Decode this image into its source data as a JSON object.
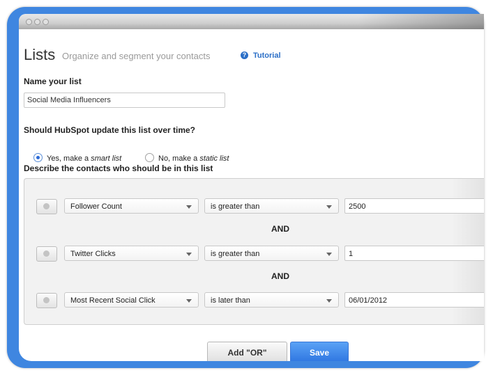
{
  "header": {
    "title": "Lists",
    "subtitle": "Organize and segment your contacts",
    "tutorial": "Tutorial"
  },
  "name_field": {
    "label": "Name your list",
    "value": "Social Media Influencers"
  },
  "update": {
    "question": "Should HubSpot update this list over time?",
    "smart": {
      "prefix": "Yes, make a ",
      "em": "smart list",
      "selected": true
    },
    "static": {
      "prefix": "No, make a ",
      "em": "static list",
      "selected": false
    }
  },
  "criteria": {
    "label": "Describe the contacts who should be in this list",
    "rows": [
      {
        "property": "Follower Count",
        "operator": "is greater than",
        "value": "2500"
      },
      {
        "property": "Twitter Clicks",
        "operator": "is greater than",
        "value": "1"
      },
      {
        "property": "Most Recent Social Click",
        "operator": "is later than",
        "value": "06/01/2012"
      }
    ],
    "joiner": "AND"
  },
  "buttons": {
    "add_or": "Add \"OR\"",
    "save": "Save"
  },
  "colors": {
    "accent": "#2b6fc7",
    "frame": "#3f86e0",
    "save": "#2d74e0"
  }
}
